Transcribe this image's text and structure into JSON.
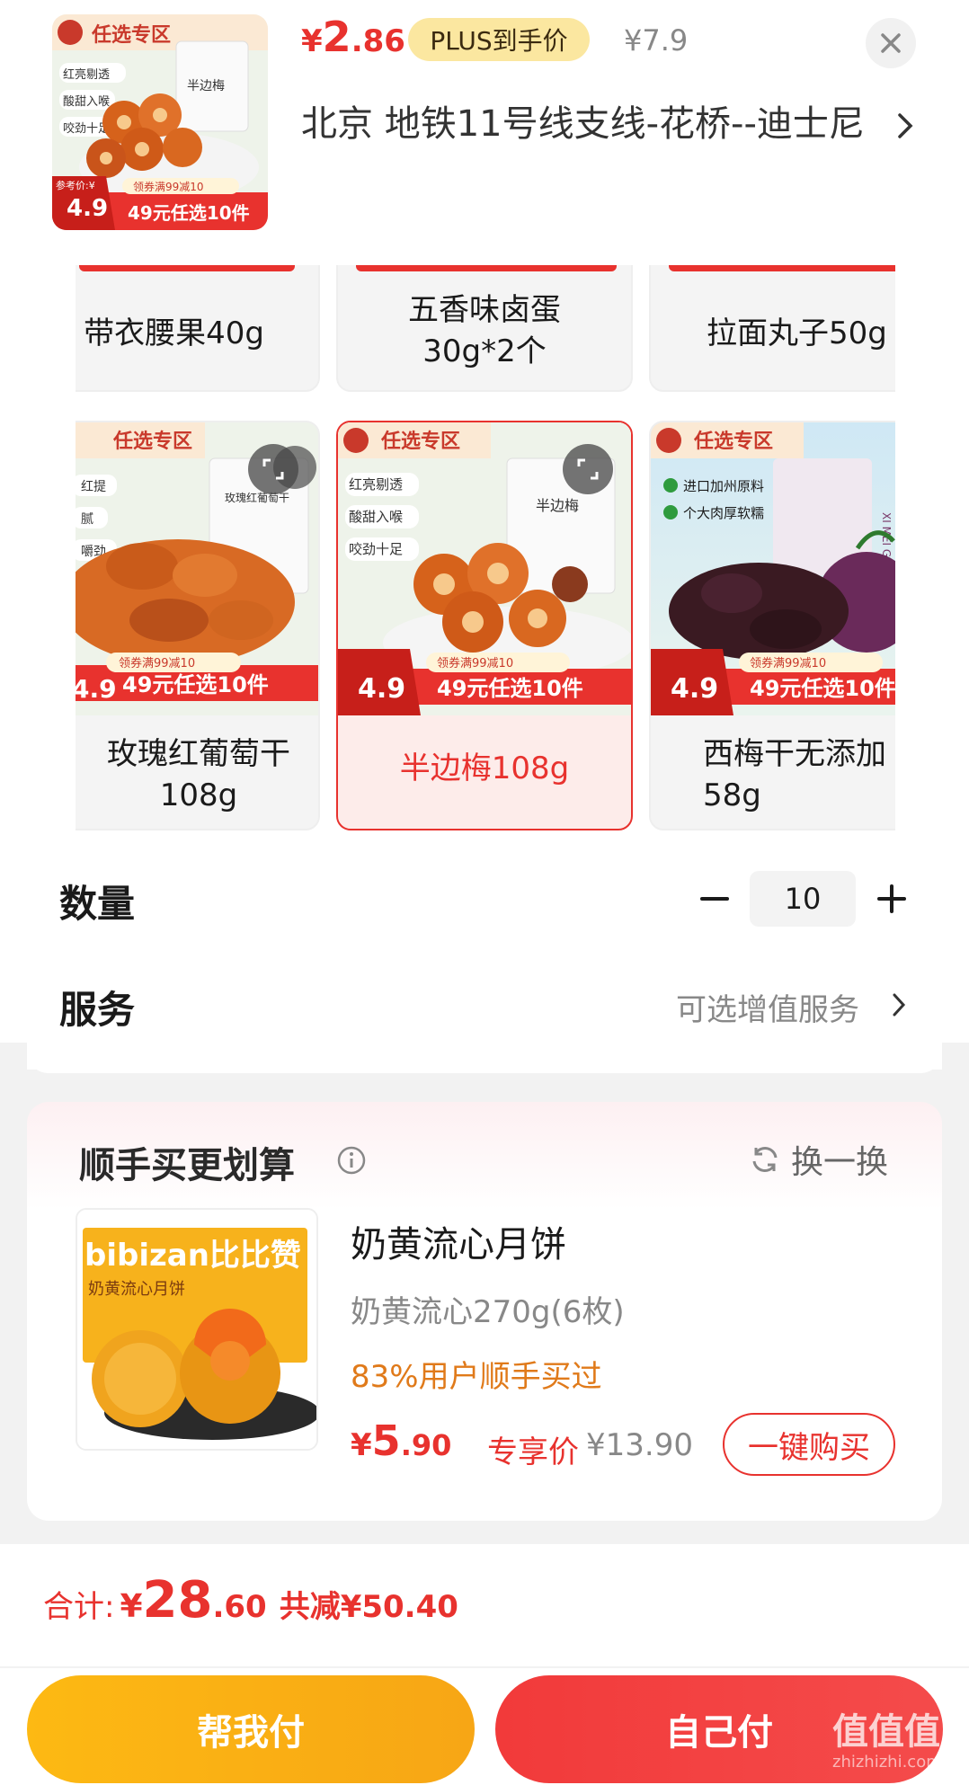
{
  "header": {
    "price_currency": "¥",
    "price_int": "2",
    "price_dec": ".86",
    "plus_label": "PLUS到手价",
    "original_price": "¥7.9",
    "address": "北京  地铁11号线支线-花桥--迪士尼",
    "thumb": {
      "badge": "任选专区",
      "tags": [
        "红亮剔透",
        "酸甜入喉",
        "咬劲十足"
      ],
      "product_label": "半边梅",
      "ref_label": "参考价:¥",
      "ref_price": "4.9",
      "coupon": "领券满99减10",
      "deal": "49元任选10件"
    }
  },
  "sku_top_row": [
    {
      "name": "带衣腰果40g"
    },
    {
      "name": "五香味卤蛋\n30g*2个"
    },
    {
      "name": "拉面丸子50g"
    }
  ],
  "sku_main_row": [
    {
      "name": "玫瑰红葡萄干\n108g",
      "badge": "任选专区",
      "tags": [
        "红提",
        "腻",
        "嚼劲"
      ],
      "product_label": "玫瑰红葡萄干",
      "coupon": "领券满99减10",
      "deal": "49元任选10件",
      "ref_price": "4.9"
    },
    {
      "name": "半边梅108g",
      "badge": "任选专区",
      "tags": [
        "红亮剔透",
        "酸甜入喉",
        "咬劲十足"
      ],
      "product_label": "半边梅",
      "coupon": "领券满99减10",
      "deal": "49元任选10件",
      "ref_price": "4.9",
      "selected": true
    },
    {
      "name": "西梅干无添加\n58g",
      "badge": "任选专区",
      "tags": [
        "进口加州原料",
        "个大肉厚软糯"
      ],
      "product_label": "XI MEI GAN",
      "coupon": "领券满99减10",
      "deal": "49元任选10件",
      "ref_price": "4.9"
    }
  ],
  "banner_top": "49元任选10件",
  "quantity": {
    "label": "数量",
    "value": "10"
  },
  "service": {
    "label": "服务",
    "hint": "可选增值服务"
  },
  "recommend": {
    "title": "顺手买更划算",
    "swap_label": "换一换",
    "brand_text": "bibizan比比赞",
    "box_text": "奶黄流心月饼",
    "name": "奶黄流心月饼",
    "spec": "奶黄流心270g(6枚)",
    "bought": "83%用户顺手买过",
    "price_currency": "¥",
    "price_int": "5",
    "price_dec": ".90",
    "exclusive": "专享价",
    "original_price": "¥13.90",
    "buy_label": "一键购买"
  },
  "footer": {
    "total_label": "合计:",
    "total_currency": "¥",
    "total_int": "28",
    "total_dec": ".60",
    "saved": "共减¥50.40",
    "help_pay": "帮我付",
    "self_pay": "自己付"
  },
  "watermark": {
    "main": "值值值",
    "sub": "zhizhizhi.com"
  },
  "colors": {
    "accent_red": "#e8322e",
    "accent_yellow": "#fdb913",
    "orange_text": "#e07a1a"
  },
  "icons": [
    "close-icon",
    "chevron-right-icon",
    "expand-icon",
    "minus-icon",
    "plus-icon",
    "info-icon",
    "refresh-icon"
  ]
}
